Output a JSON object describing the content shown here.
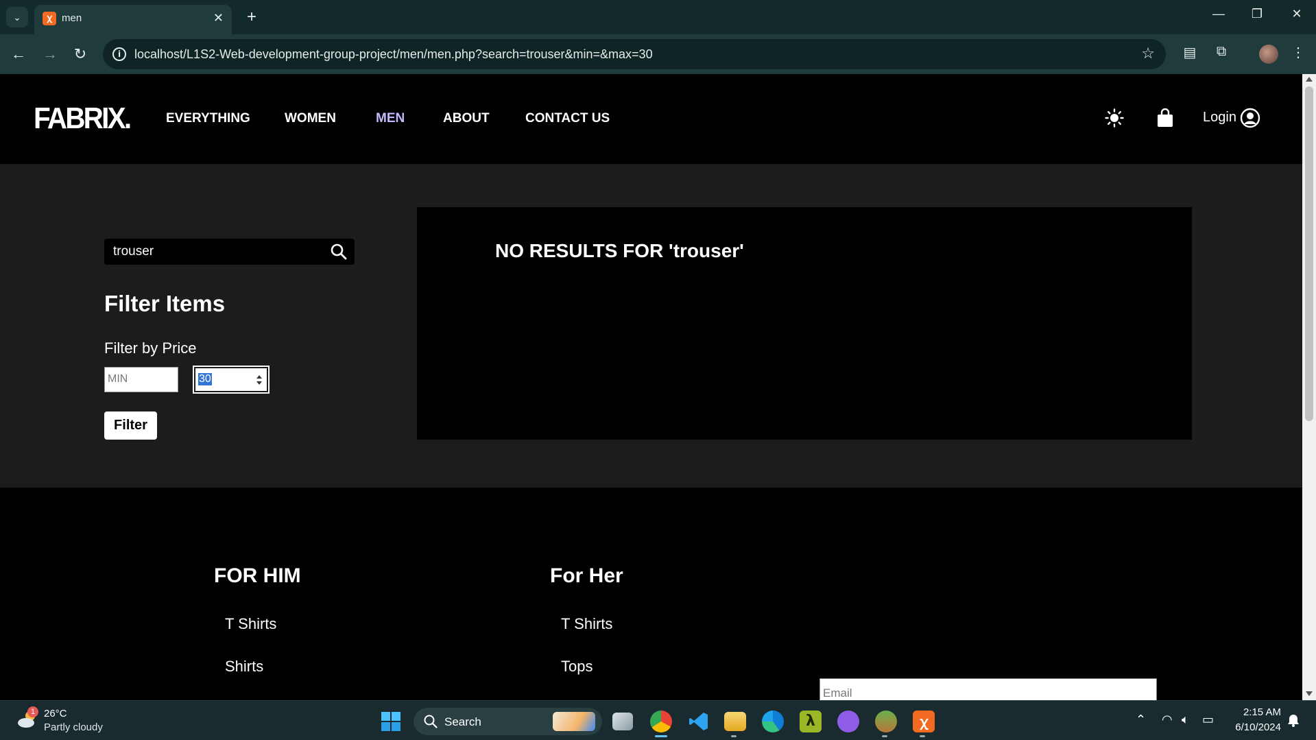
{
  "browser": {
    "tab_title": "men",
    "tab_favicon": "xampp-icon",
    "url": "localhost/L1S2-Web-development-group-project/men/men.php?search=trouser&min=&max=30"
  },
  "site": {
    "logo": "FABRIX.",
    "nav": [
      "EVERYTHING",
      "WOMEN",
      "MEN",
      "ABOUT",
      "CONTACT US"
    ],
    "active_nav": "MEN",
    "login": "Login"
  },
  "sidebar": {
    "search_value": "trouser",
    "filter_title": "Filter Items",
    "price_label": "Filter by Price",
    "min_placeholder": "MIN",
    "max_value": "30",
    "filter_button": "Filter"
  },
  "results": {
    "message": "NO RESULTS FOR 'trouser'"
  },
  "footer": {
    "for_him": {
      "heading": "FOR HIM",
      "links": [
        "T Shirts",
        "Shirts"
      ]
    },
    "for_her": {
      "heading": "For Her",
      "links": [
        "T Shirts",
        "Tops"
      ]
    },
    "email_placeholder": "Email"
  },
  "taskbar": {
    "temperature": "26°C",
    "condition": "Partly cloudy",
    "weather_badge": "1",
    "search_label": "Search",
    "time": "2:15 AM",
    "date": "6/10/2024"
  },
  "colors": {
    "accent_nav": "#c7b8ff",
    "page_bg": "#1c1c1e",
    "header_bg": "#000000"
  }
}
